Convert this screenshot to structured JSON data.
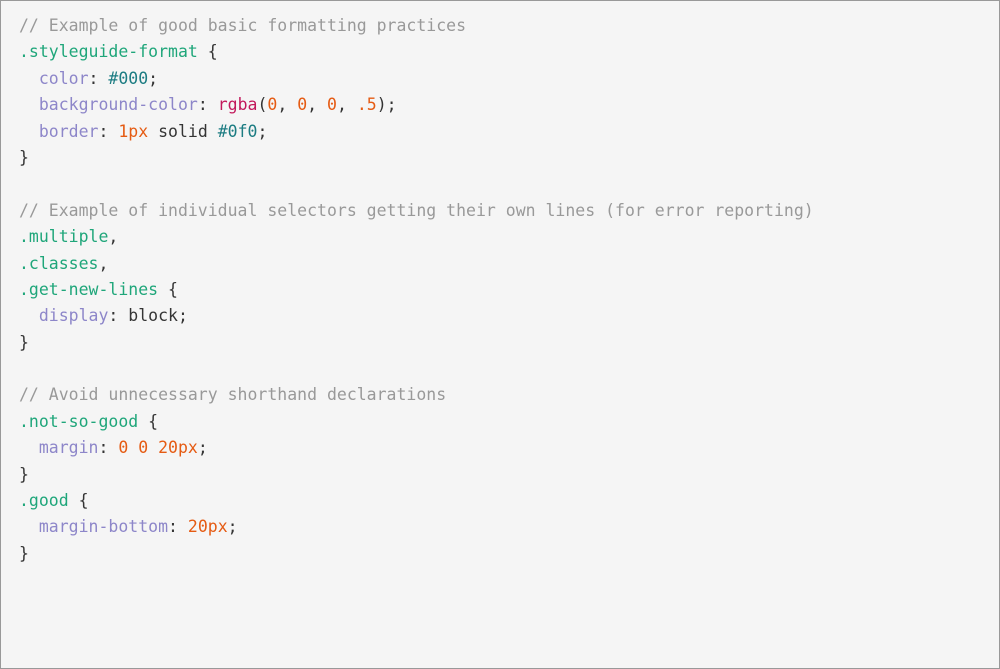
{
  "code": {
    "comments": {
      "c1": "// Example of good basic formatting practices",
      "c2": "// Example of individual selectors getting their own lines (for error reporting)",
      "c3": "// Avoid unnecessary shorthand declarations"
    },
    "selectors": {
      "styleguide": ".styleguide-format",
      "multiple": ".multiple",
      "classes": ".classes",
      "getNewLines": ".get-new-lines",
      "notSoGood": ".not-so-good",
      "good": ".good"
    },
    "properties": {
      "color": "color",
      "backgroundColor": "background-color",
      "border": "border",
      "display": "display",
      "margin": "margin",
      "marginBottom": "margin-bottom"
    },
    "values": {
      "hex000": "#000",
      "hex0f0": "#0f0",
      "rgbaFn": "rgba",
      "zero": "0",
      "point5": ".5",
      "onepx": "1px",
      "solid": "solid",
      "block": "block",
      "twentypx": "20px"
    },
    "punct": {
      "openBrace": " {",
      "closeBrace": "}",
      "colon": ":",
      "semicolon": ";",
      "comma": ",",
      "commaSpace": ", ",
      "openParen": "(",
      "closeParen": ")",
      "indent": "  ",
      "space": " "
    }
  }
}
